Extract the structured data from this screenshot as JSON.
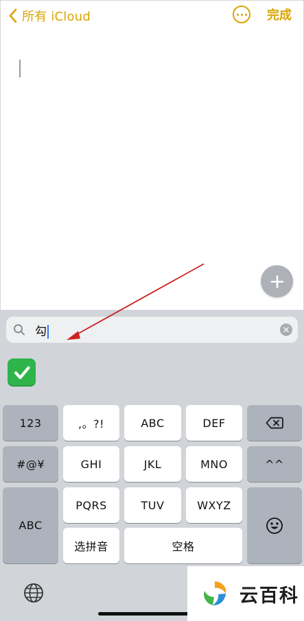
{
  "nav": {
    "back_label": "所有 iCloud",
    "done_label": "完成"
  },
  "search": {
    "query": "勾"
  },
  "candidate": {
    "emoji_name": "white-heavy-check-mark",
    "color": "#2fb44a"
  },
  "keyboard": {
    "keys": {
      "k123": "123",
      "punct": ",。?!",
      "abc": "ABC",
      "def": "DEF",
      "symbols": "#@¥",
      "ghi": "GHI",
      "jkl": "JKL",
      "mno": "MNO",
      "caret": "^^",
      "abc_mode": "ABC",
      "pqrs": "PQRS",
      "tuv": "TUV",
      "wxyz": "WXYZ",
      "pinyin": "选拼音",
      "space": "空格"
    }
  },
  "watermark": {
    "text": "云百科"
  },
  "colors": {
    "accent": "#d9a400",
    "annotation_arrow": "#cc2222",
    "keyboard_bg": "#d1d4d9"
  }
}
